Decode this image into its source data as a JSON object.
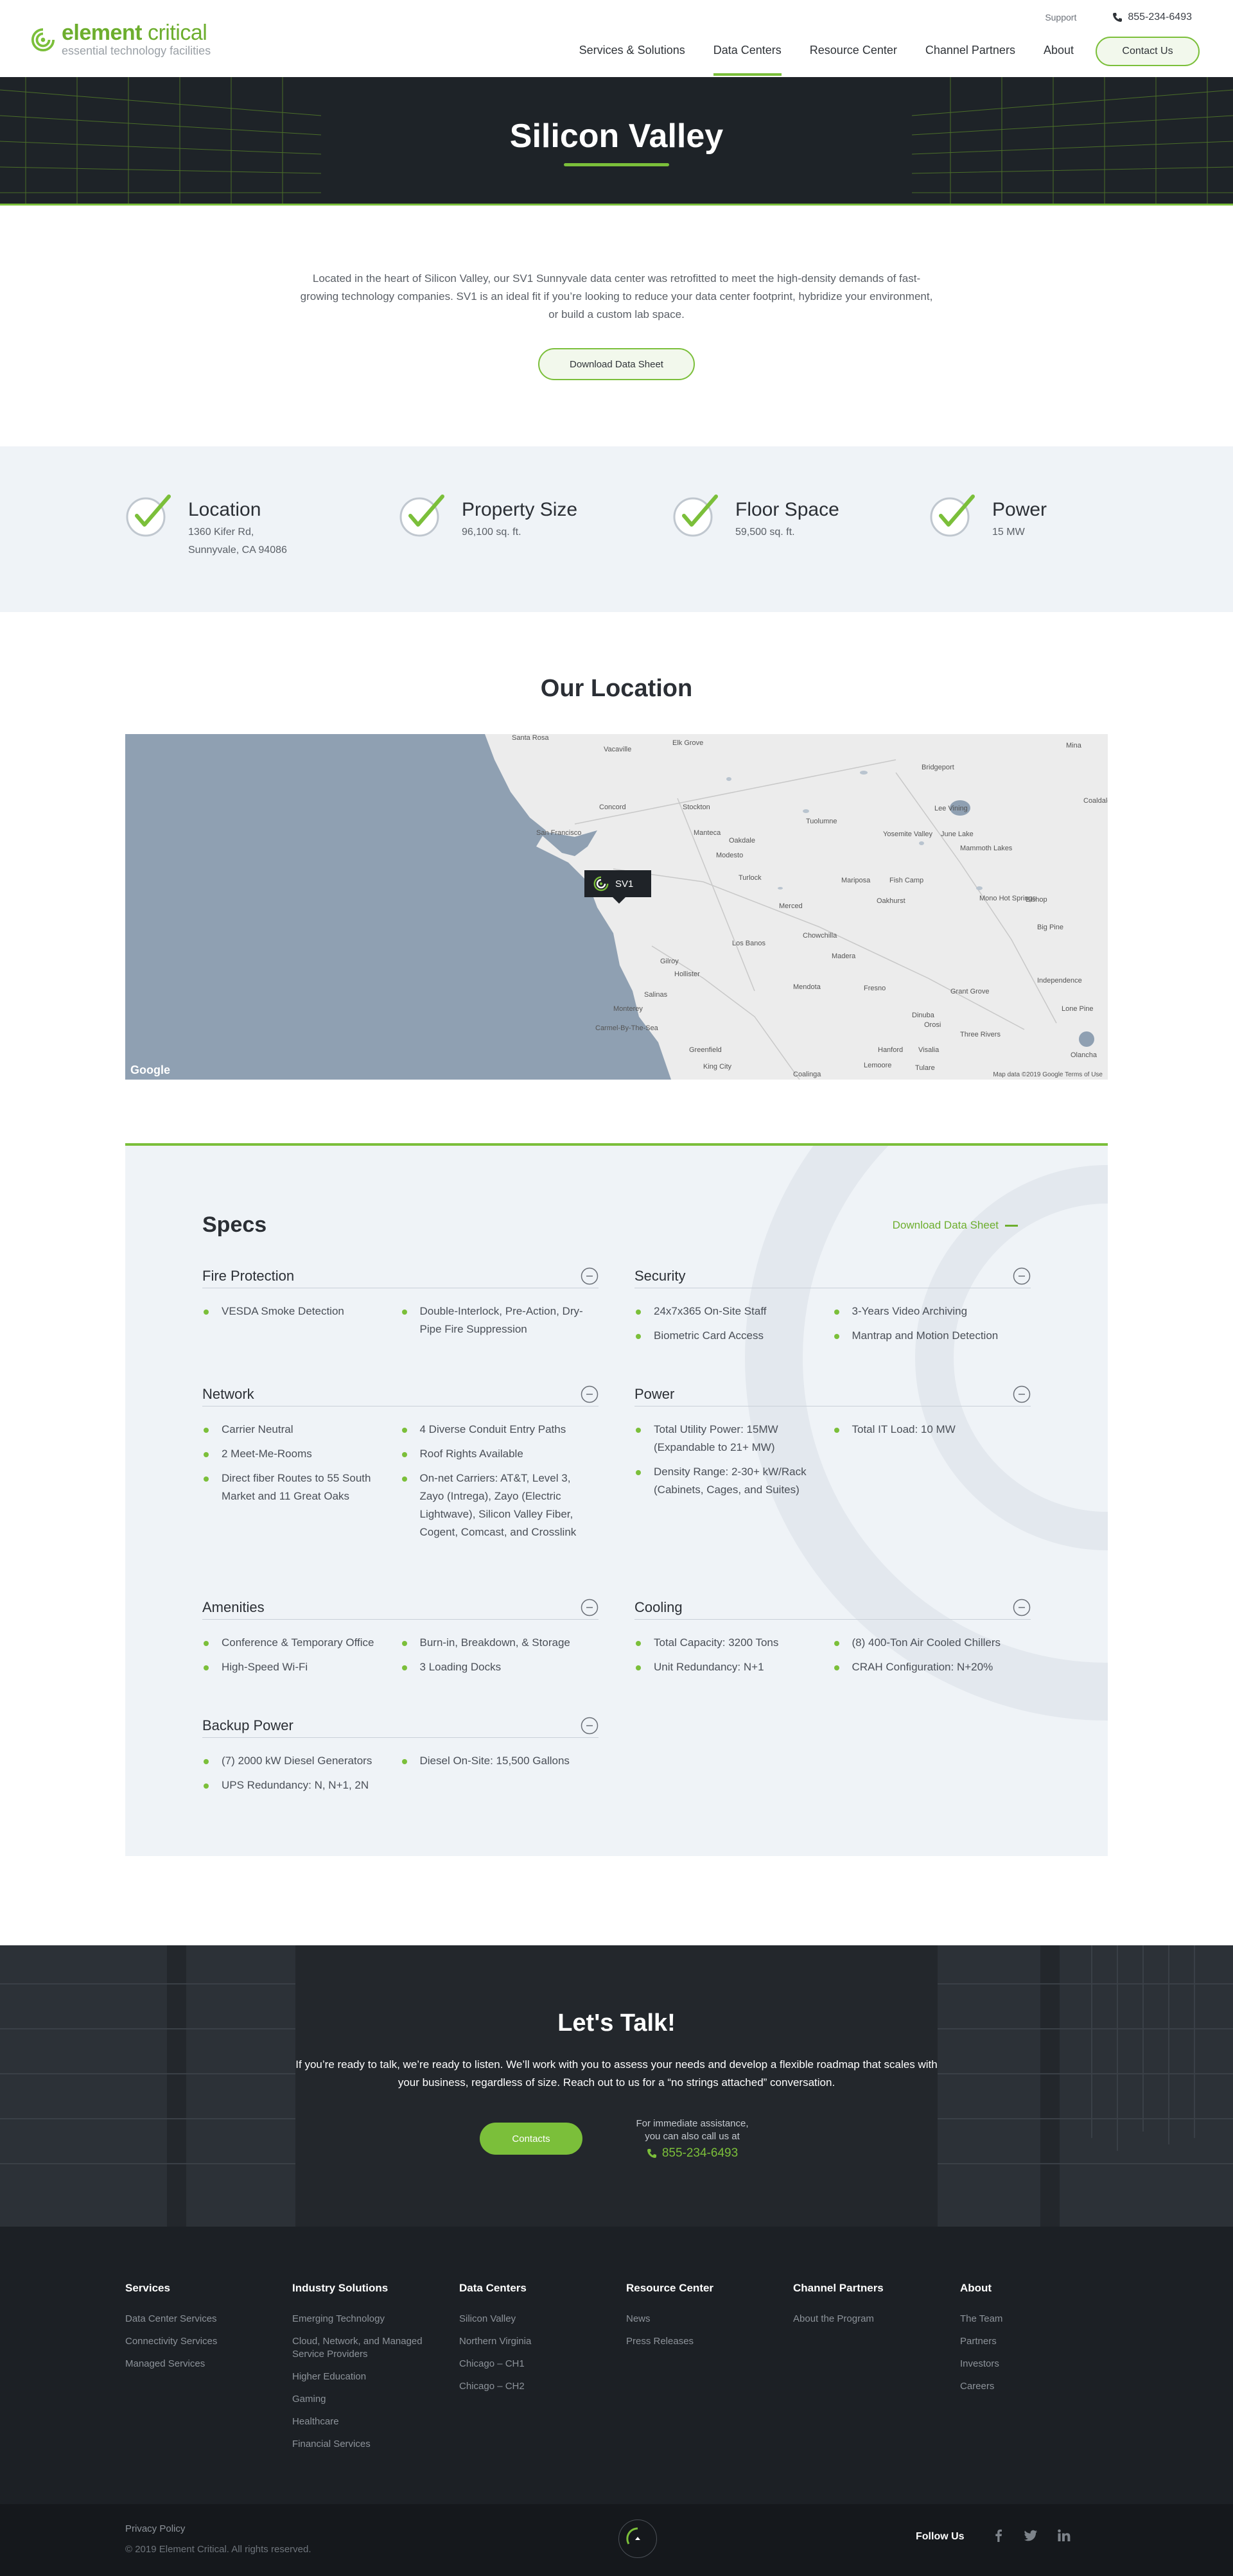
{
  "header": {
    "logo_name_bold": "element",
    "logo_name_rest": " critical",
    "logo_tagline": "essential technology facilities",
    "support_link": "Support",
    "phone": "855-234-6493",
    "nav": [
      "Services & Solutions",
      "Data Centers",
      "Resource Center",
      "Channel Partners",
      "About"
    ],
    "contact_button": "Contact Us"
  },
  "hero": {
    "title": "Silicon Valley"
  },
  "intro": {
    "text": "Located in the heart of Silicon Valley, our SV1 Sunnyvale data center was retrofitted to meet the high-density demands of fast-growing technology companies. SV1 is an ideal fit if you’re looking to reduce your data center footprint, hybridize your environment, or build a custom lab space.",
    "button": "Download Data Sheet"
  },
  "stats": [
    {
      "title": "Location",
      "value": "1360 Kifer Rd,",
      "value2": "Sunnyvale, CA 94086"
    },
    {
      "title": "Property Size",
      "value": "96,100 sq. ft.",
      "value2": ""
    },
    {
      "title": "Floor Space",
      "value": "59,500 sq. ft.",
      "value2": ""
    },
    {
      "title": "Power",
      "value": "15 MW",
      "value2": ""
    }
  ],
  "location": {
    "title": "Our Location",
    "pin_label": "SV1",
    "attribution": "Map data ©2019 Google   Terms of Use",
    "google": "Google",
    "cities": [
      "Santa Rosa",
      "Vacaville",
      "Elk Grove",
      "Concord",
      "Stockton",
      "San Francisco",
      "Manteca",
      "Modesto",
      "Turlock",
      "Merced",
      "Gilroy",
      "Los Banos",
      "Chowchilla",
      "Hollister",
      "Madera",
      "Salinas",
      "Mendota",
      "Fresno",
      "Monterey",
      "Carmel-By-The-Sea",
      "Greenfield",
      "King City",
      "Hanford",
      "Visalia",
      "Lemoore",
      "Tulare",
      "Coalinga",
      "Bridgeport",
      "Lee Vining",
      "Mammoth Lakes",
      "Bishop",
      "Big Pine",
      "Independence",
      "Lone Pine",
      "Olancha",
      "Three Rivers",
      "Oakhurst",
      "Mariposa",
      "Fish Camp",
      "Yosemite Valley",
      "June Lake",
      "Grant Grove",
      "Orosi",
      "Dinuba",
      "Mono Hot Springs",
      "Tuolumne",
      "Oakdale",
      "Mina",
      "Coaldale"
    ]
  },
  "specs": {
    "title": "Specs",
    "download": "Download Data Sheet",
    "sections": [
      {
        "name": "Fire Protection",
        "col1": [
          "VESDA Smoke Detection"
        ],
        "col2": [
          "Double-Interlock, Pre-Action, Dry-Pipe Fire Suppression"
        ]
      },
      {
        "name": "Security",
        "col1": [
          "24x7x365 On-Site Staff",
          "Biometric Card Access"
        ],
        "col2": [
          "3-Years Video Archiving",
          "Mantrap and Motion Detection"
        ]
      },
      {
        "name": "Network",
        "col1": [
          "Carrier Neutral",
          "2 Meet-Me-Rooms",
          "Direct fiber Routes to 55 South Market and 11 Great Oaks"
        ],
        "col2": [
          "4 Diverse Conduit Entry Paths",
          "Roof Rights Available",
          "On-net Carriers: AT&T, Level 3, Zayo (Intrega), Zayo (Electric Lightwave), Silicon Valley Fiber, Cogent, Comcast, and Crosslink"
        ]
      },
      {
        "name": "Power",
        "col1": [
          "Total Utility Power: 15MW (Expandable to 21+ MW)",
          "Density Range: 2-30+ kW/Rack (Cabinets, Cages, and Suites)"
        ],
        "col2": [
          "Total IT Load: 10 MW"
        ]
      },
      {
        "name": "Amenities",
        "col1": [
          "Conference & Temporary Office",
          "High-Speed Wi-Fi"
        ],
        "col2": [
          "Burn-in, Breakdown, & Storage",
          "3 Loading Docks"
        ]
      },
      {
        "name": "Cooling",
        "col1": [
          "Total Capacity: 3200 Tons",
          "Unit Redundancy: N+1"
        ],
        "col2": [
          "(8) 400-Ton Air Cooled Chillers",
          "CRAH Configuration: N+20%"
        ]
      },
      {
        "name": "Backup Power",
        "col1": [
          "(7) 2000 kW Diesel Generators",
          "UPS Redundancy: N, N+1, 2N"
        ],
        "col2": [
          "Diesel On-Site: 15,500 Gallons"
        ]
      }
    ]
  },
  "talk": {
    "title": "Let's Talk!",
    "text": "If you’re ready to talk, we’re ready to listen. We’ll work with you to assess your needs and develop a flexible roadmap that scales with your business, regardless of size. Reach out to us for a “no strings attached” conversation.",
    "button": "Contacts",
    "call_line1": "For immediate assistance,",
    "call_line2": "you can also call us at",
    "phone": "855-234-6493"
  },
  "footer": {
    "columns": [
      {
        "title": "Services",
        "links": [
          "Data Center Services",
          "Connectivity Services",
          "Managed Services"
        ]
      },
      {
        "title": "Industry Solutions",
        "links": [
          "Emerging Technology",
          "Cloud, Network, and Managed Service Providers",
          "Higher Education",
          "Gaming",
          "Healthcare",
          "Financial Services"
        ]
      },
      {
        "title": "Data Centers",
        "links": [
          "Silicon Valley",
          "Northern Virginia",
          "Chicago – CH1",
          "Chicago – CH2"
        ]
      },
      {
        "title": "Resource Center",
        "links": [
          "News",
          "Press Releases"
        ]
      },
      {
        "title": "Channel Partners",
        "links": [
          "About the Program"
        ]
      },
      {
        "title": "About",
        "links": [
          "The Team",
          "Partners",
          "Investors",
          "Careers"
        ]
      }
    ],
    "privacy": "Privacy Policy",
    "copyright": "© 2019 Element Critical. All rights reserved.",
    "follow": "Follow Us"
  },
  "colors": {
    "accent": "#7bbf3a",
    "dark": "#1e2328",
    "band": "#eff3f7",
    "water": "#8fa0b2"
  }
}
